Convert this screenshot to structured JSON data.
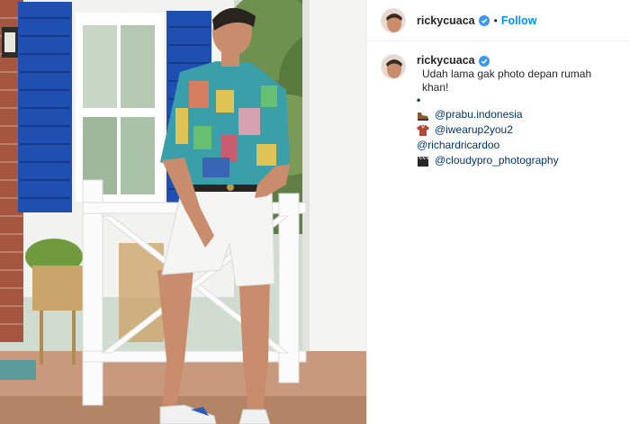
{
  "post": {
    "author": {
      "username": "rickycuaca",
      "verified": true,
      "avatar_icon": "profile-avatar"
    },
    "header": {
      "separator": "•",
      "follow_label": "Follow"
    },
    "caption": {
      "text": "Udah lama gak photo depan rumah khan!",
      "bullet": "•",
      "credits": [
        {
          "icon": "shoe-icon",
          "mention": "@prabu.indonesia"
        },
        {
          "icon": "shirt-icon",
          "mention": "@iwearup2you2"
        },
        {
          "icon": "",
          "mention": "@richardricardoo"
        },
        {
          "icon": "clapperboard-icon",
          "mention": "@cloudypro_photography"
        }
      ]
    },
    "colors": {
      "follow_blue": "#0095f6",
      "mention_blue": "#00376b",
      "verified_blue": "#3897f0",
      "shutter_blue": "#1f4fb0"
    }
  }
}
